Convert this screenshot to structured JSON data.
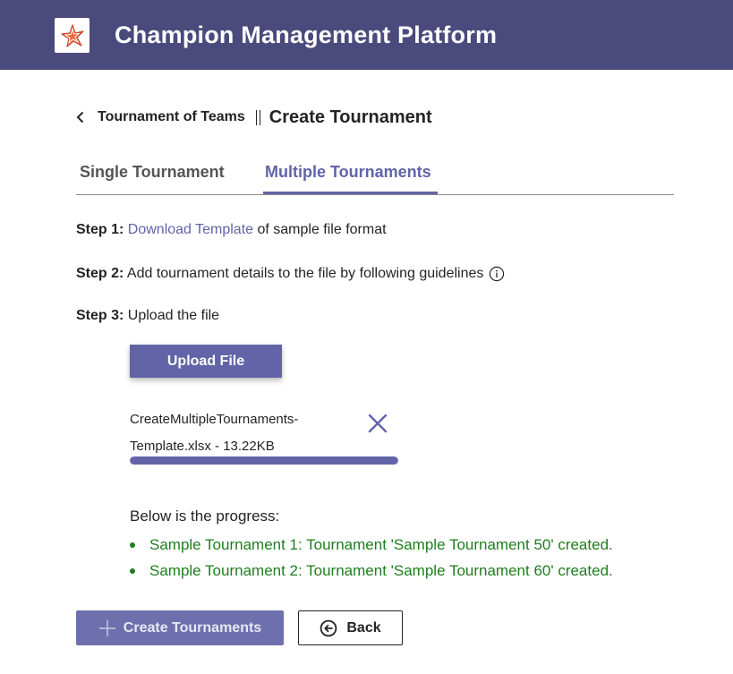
{
  "header": {
    "app_title": "Champion Management Platform",
    "logo_icon": "starfish-logo-icon"
  },
  "breadcrumb": {
    "parent": "Tournament of Teams",
    "current": "Create Tournament"
  },
  "tabs": [
    {
      "label": "Single Tournament",
      "selected": false
    },
    {
      "label": "Multiple Tournaments",
      "selected": true
    }
  ],
  "steps": {
    "step1_label": "Step 1:",
    "step1_link": "Download Template",
    "step1_text": " of sample file format",
    "step2_label": "Step 2:",
    "step2_text": " Add tournament details to the file by following guidelines",
    "step3_label": "Step 3:",
    "step3_text": " Upload the file"
  },
  "upload": {
    "button_label": "Upload File",
    "file_line1": "CreateMultipleTournaments-",
    "file_line2": "Template.xlsx - 13.22KB",
    "progress": 1.0
  },
  "progress": {
    "label": "Below is the progress:",
    "results": [
      "Sample Tournament 1: Tournament 'Sample Tournament 50' created.",
      "Sample Tournament 2: Tournament 'Sample Tournament 60' created."
    ]
  },
  "actions": {
    "create_label": "Create Tournaments",
    "back_label": "Back"
  },
  "colors": {
    "header_bg": "#4a4a7c",
    "accent": "#6264a7",
    "success": "#1e7e1e"
  }
}
